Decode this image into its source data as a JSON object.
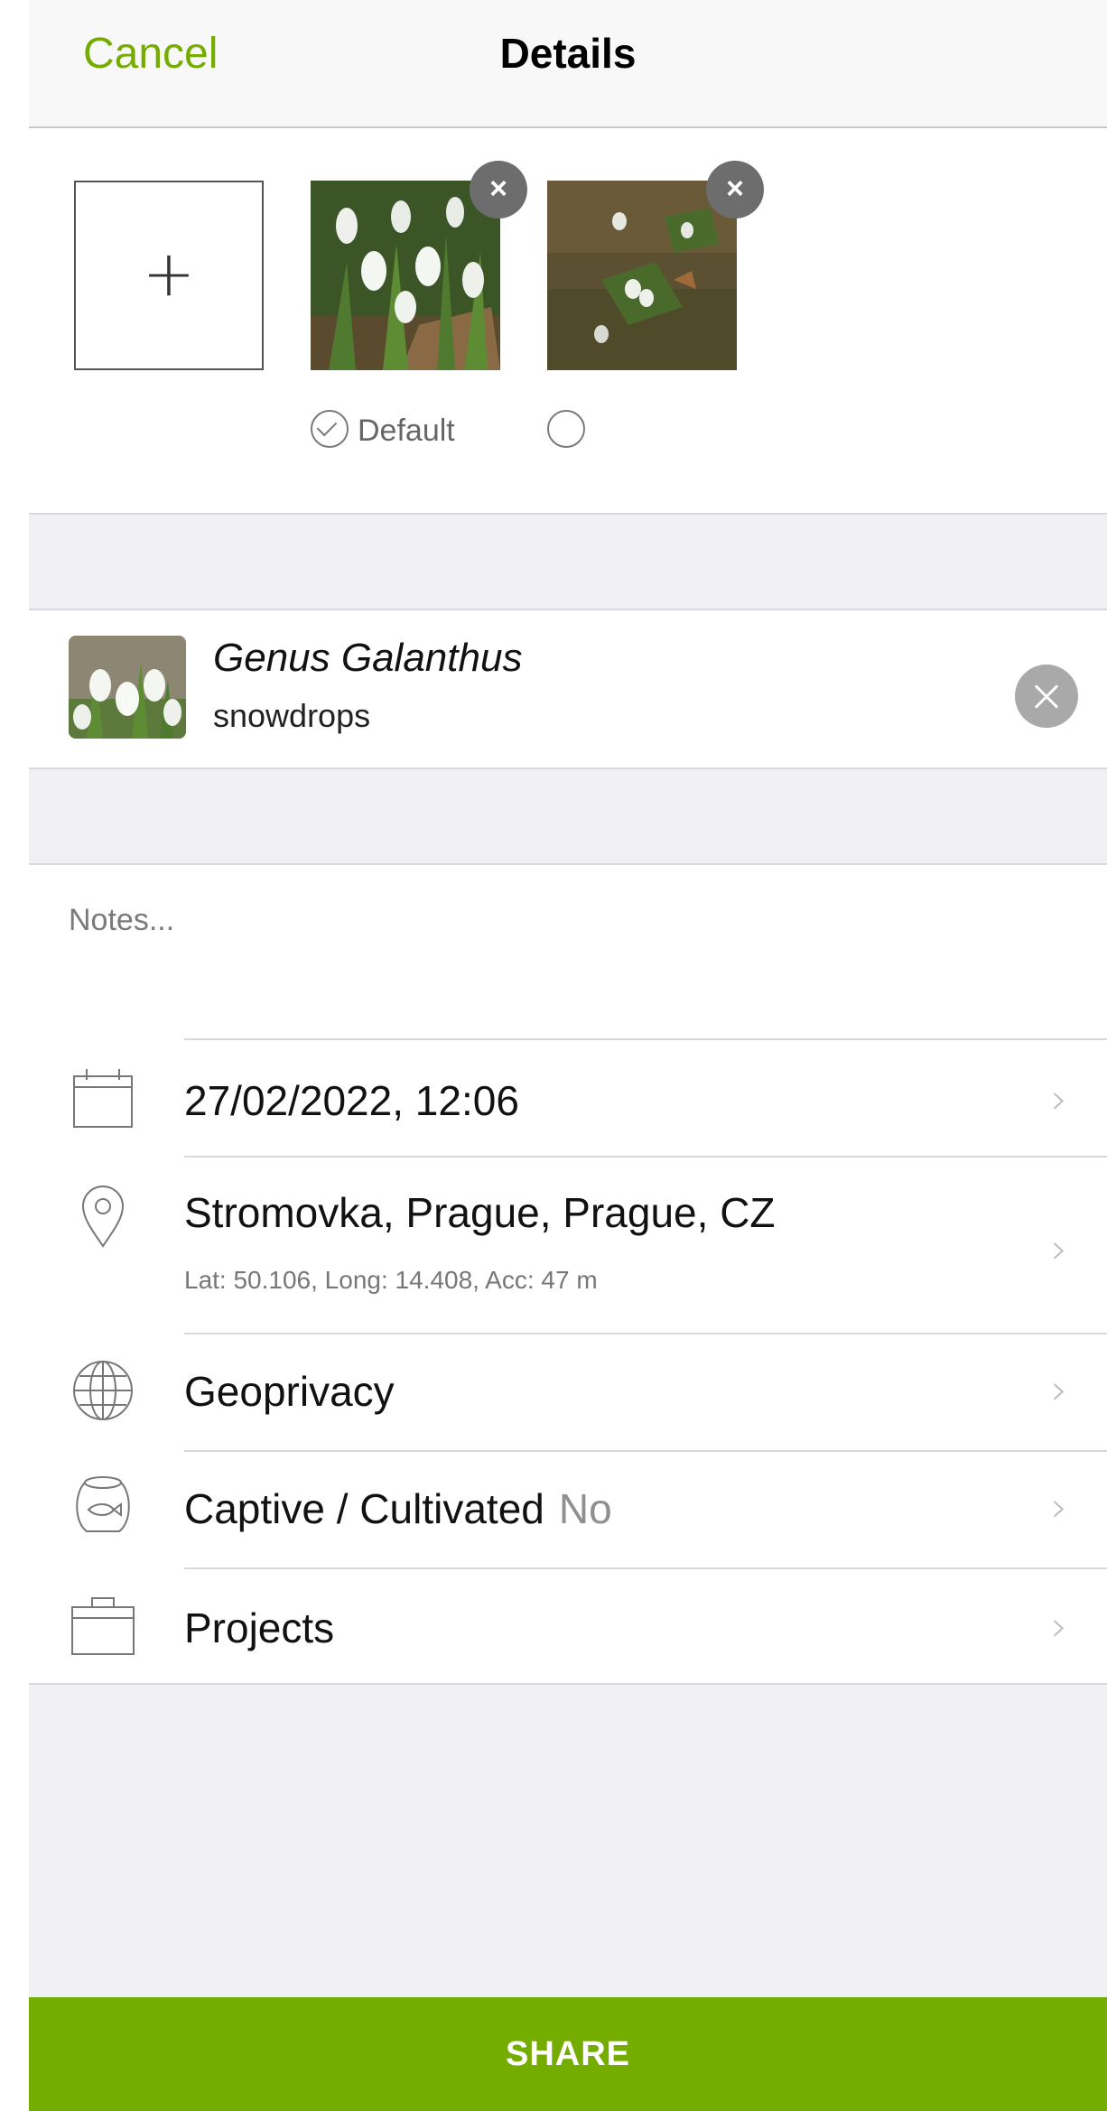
{
  "navbar": {
    "cancel_label": "Cancel",
    "title": "Details"
  },
  "photos": {
    "add_symbol": "+",
    "default_label": "Default",
    "close_symbol": "×",
    "items": [
      {
        "is_default": true
      },
      {
        "is_default": false
      }
    ]
  },
  "taxon": {
    "scientific_name": "Genus Galanthus",
    "common_name": "snowdrops"
  },
  "notes": {
    "placeholder": "Notes...",
    "value": ""
  },
  "details": {
    "date": {
      "label": "27/02/2022, 12:06",
      "icon": "calendar-icon"
    },
    "location": {
      "label": "Stromovka, Prague, Prague, CZ",
      "coords": "Lat: 50.106, Long: 14.408, Acc: 47 m",
      "icon": "map-pin-icon"
    },
    "geoprivacy": {
      "label": "Geoprivacy",
      "icon": "globe-icon"
    },
    "captive": {
      "label": "Captive / Cultivated",
      "value": "No",
      "icon": "fishbowl-icon"
    },
    "projects": {
      "label": "Projects",
      "icon": "briefcase-icon"
    },
    "chevron": "›"
  },
  "share": {
    "label": "SHARE"
  },
  "colors": {
    "accent": "#74ac00",
    "background_gray": "#f0f0f5",
    "separator": "#d8d8dc"
  }
}
